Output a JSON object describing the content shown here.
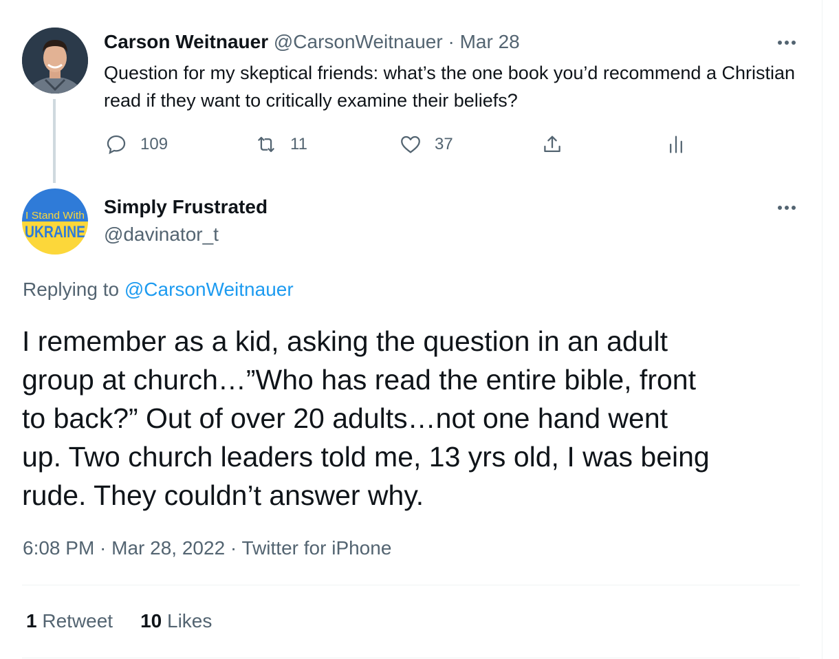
{
  "parent_tweet": {
    "display_name": "Carson Weitnauer",
    "handle": "@CarsonWeitnauer",
    "separator": "·",
    "date": "Mar 28",
    "text": "Question for my skeptical friends: what’s the one book you’d recommend a Christian read if they want to critically examine their beliefs?",
    "reply_count": "109",
    "retweet_count": "11",
    "like_count": "37",
    "icons": [
      "more-icon",
      "reply-icon",
      "retweet-icon",
      "like-icon",
      "share-icon",
      "analytics-icon"
    ]
  },
  "reply_tweet": {
    "display_name": "Simply Frustrated",
    "handle": "@davinator_t",
    "avatar_text_top": "I Stand With",
    "avatar_text_bottom": "UKRAINE",
    "avatar_colors": {
      "top": "#2f7bd8",
      "bottom": "#fcd73a"
    },
    "replying_prefix": "Replying to",
    "replying_to": "@CarsonWeitnauer",
    "text": "I remember as a kid, asking the question in an adult\ngroup at church…”Who has read the entire bible, front\nto back?”  Out of over 20 adults…not one hand went\nup.  Two church leaders told me, 13 yrs old, I was being\nrude. They couldn’t answer why.",
    "timestamp": "6:08 PM · Mar 28, 2022 · Twitter for iPhone",
    "retweets_count": "1",
    "retweets_label": "Retweet",
    "likes_count": "10",
    "likes_label": "Likes"
  },
  "colors": {
    "text": "#0f1419",
    "secondary": "#536471",
    "link": "#1d9bf0",
    "border": "#eff3f4"
  }
}
